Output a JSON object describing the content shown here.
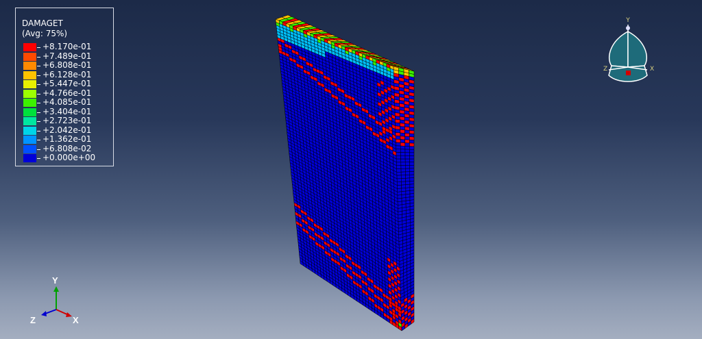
{
  "viewport": {
    "background_top": "#1c2a48",
    "background_bottom": "#a4aec0"
  },
  "legend": {
    "title": "DAMAGET",
    "subtitle": "(Avg: 75%)",
    "entries": [
      {
        "label": "+8.170e-01",
        "color": "#ff0000"
      },
      {
        "label": "+7.489e-01",
        "color": "#ff4a00"
      },
      {
        "label": "+6.808e-01",
        "color": "#ff8a00"
      },
      {
        "label": "+6.128e-01",
        "color": "#ffc400"
      },
      {
        "label": "+5.447e-01",
        "color": "#e8f000"
      },
      {
        "label": "+4.766e-01",
        "color": "#9cff00"
      },
      {
        "label": "+4.085e-01",
        "color": "#3cf000"
      },
      {
        "label": "+3.404e-01",
        "color": "#00e03c"
      },
      {
        "label": "+2.723e-01",
        "color": "#00e6a0"
      },
      {
        "label": "+2.042e-01",
        "color": "#00d4e8"
      },
      {
        "label": "+1.362e-01",
        "color": "#0094ff"
      },
      {
        "label": "+6.808e-02",
        "color": "#0050ff"
      },
      {
        "label": "+0.000e+00",
        "color": "#0000d8"
      }
    ]
  },
  "model": {
    "base_color": "#0000d8",
    "damage_colors": {
      "high": "#ff0000",
      "mid": "#00c0ff",
      "warm": "#ffc400",
      "green": "#3cf000"
    }
  },
  "view_cube": {
    "label_y": "Y",
    "label_x": "X",
    "label_z": "Z",
    "fill": "#1e6b7a",
    "marker_color": "#d00000"
  },
  "triad": {
    "label_y": "Y",
    "label_x": "X",
    "label_z": "Z",
    "color_y": "#00a000",
    "color_x": "#d00000",
    "color_z": "#0000d0"
  }
}
